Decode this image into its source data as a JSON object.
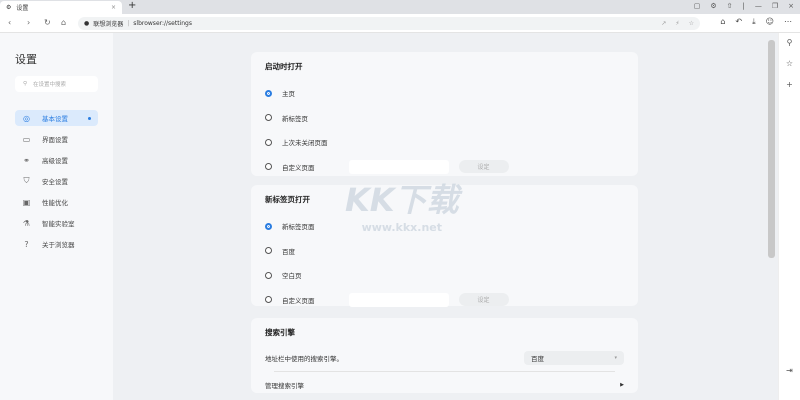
{
  "tab": {
    "title": "设置",
    "close": "×",
    "new_tab": "+"
  },
  "window": {
    "controls": [
      "▢",
      "⚙",
      "⇧",
      "|",
      "—",
      "❐",
      "×"
    ]
  },
  "address": {
    "site_name": "联想浏览器",
    "url": "slbrowser://settings",
    "icons": [
      "↗",
      "⚡",
      "☆"
    ]
  },
  "toolbar_icons": [
    "⌂",
    "↶",
    "⤓",
    "☺",
    "⋯"
  ],
  "sidebar": {
    "title": "设置",
    "search_placeholder": "在设置中搜索",
    "items": [
      {
        "label": "基本设置",
        "icon": "◎"
      },
      {
        "label": "界面设置",
        "icon": "▭"
      },
      {
        "label": "高级设置",
        "icon": "⚭"
      },
      {
        "label": "安全设置",
        "icon": "⛉"
      },
      {
        "label": "性能优化",
        "icon": "▣"
      },
      {
        "label": "智能实验室",
        "icon": "⚗"
      },
      {
        "label": "关于浏览器",
        "icon": "?"
      }
    ]
  },
  "startup": {
    "title": "启动时打开",
    "options": [
      "主页",
      "新标签页",
      "上次未关闭页面",
      "自定义页面"
    ],
    "set_label": "设定"
  },
  "newtab": {
    "title": "新标签页打开",
    "options": [
      "新标签页面",
      "百度",
      "空白页",
      "自定义页面"
    ],
    "set_label": "设定"
  },
  "search_engine": {
    "title": "搜索引擎",
    "label": "地址栏中使用的搜索引擎。",
    "value": "百度",
    "manage_label": "管理搜索引擎"
  },
  "watermark": {
    "logo": "KK下载",
    "url": "www.kkx.net"
  }
}
